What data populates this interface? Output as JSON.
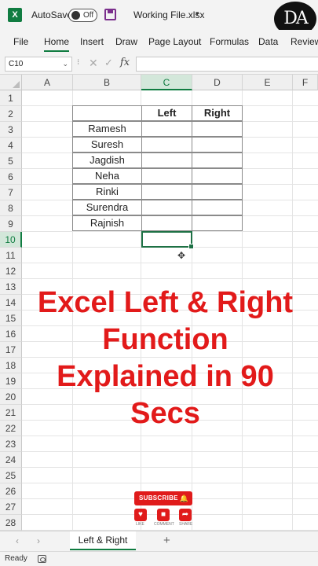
{
  "titlebar": {
    "app_icon": "excel-icon",
    "app_icon_letter": "X",
    "autosave_label": "AutoSave",
    "autosave_state": "Off",
    "save_icon": "save-icon",
    "file_name": "Working File.xlsx",
    "dropdown_caret": "▾",
    "channel_logo_text": "DA"
  },
  "ribbon": {
    "tabs": [
      {
        "label": "File",
        "active": false
      },
      {
        "label": "Home",
        "active": true
      },
      {
        "label": "Insert",
        "active": false
      },
      {
        "label": "Draw",
        "active": false
      },
      {
        "label": "Page Layout",
        "active": false
      },
      {
        "label": "Formulas",
        "active": false
      },
      {
        "label": "Data",
        "active": false
      },
      {
        "label": "Review",
        "active": false
      }
    ],
    "accent_color": "#107c41"
  },
  "formula_bar": {
    "name_box_value": "C10",
    "name_box_caret": "⌄",
    "separator": "⁝",
    "cancel_symbol": "✕",
    "enter_symbol": "✓",
    "fx_label": "fx",
    "formula_value": ""
  },
  "grid": {
    "columns": [
      "A",
      "B",
      "C",
      "D",
      "E",
      "F"
    ],
    "selected_column": "C",
    "rows": [
      "1",
      "2",
      "3",
      "4",
      "5",
      "6",
      "7",
      "8",
      "9",
      "10",
      "11",
      "12",
      "13",
      "14",
      "15",
      "16",
      "17",
      "18",
      "19",
      "20",
      "21",
      "22",
      "23",
      "24",
      "25",
      "26",
      "27",
      "28"
    ],
    "selected_row": "10"
  },
  "table": {
    "headers": [
      "",
      "Left",
      "Right"
    ],
    "names": [
      "Ramesh",
      "Suresh",
      "Jagdish",
      "Neha",
      "Rinki",
      "Surendra",
      "Rajnish"
    ]
  },
  "overlay": {
    "title_lines": [
      "Excel Left & Right",
      "Function",
      "Explained in 90",
      "Secs"
    ],
    "title_color": "#e21a1a"
  },
  "subscribe_widget": {
    "button_label": "SUBSCRIBE",
    "bell_icon": "🔔",
    "items": [
      {
        "icon": "heart-icon",
        "glyph": "♥",
        "label": "LIKE"
      },
      {
        "icon": "comment-icon",
        "glyph": "■",
        "label": "COMMENT"
      },
      {
        "icon": "share-icon",
        "glyph": "➦",
        "label": "SHARE"
      }
    ]
  },
  "sheet_tabs": {
    "prev_symbol": "‹",
    "next_symbol": "›",
    "active_sheet": "Left & Right",
    "add_symbol": "+"
  },
  "status_bar": {
    "status": "Ready"
  }
}
